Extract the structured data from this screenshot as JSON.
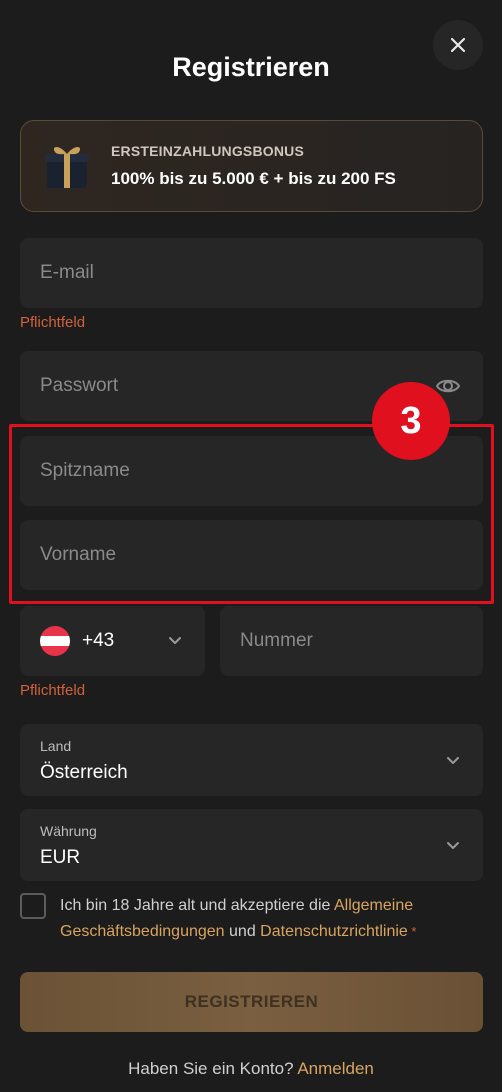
{
  "header": {
    "title": "Registrieren",
    "close_icon": "close-icon"
  },
  "bonus": {
    "label": "ERSTEINZAHLUNGSBONUS",
    "value": "100% bis zu 5.000 € + bis zu 200 FS",
    "icon": "gift-icon"
  },
  "fields": {
    "email": {
      "placeholder": "E-mail",
      "error": "Pflichtfeld"
    },
    "password": {
      "placeholder": "Passwort",
      "icon": "eye-icon"
    },
    "nickname": {
      "placeholder": "Spitzname"
    },
    "firstname": {
      "placeholder": "Vorname"
    },
    "phone": {
      "country_code": "+43",
      "placeholder": "Nummer",
      "error": "Pflichtfeld",
      "flag": "austria-flag-icon"
    }
  },
  "country": {
    "label": "Land",
    "value": "Österreich"
  },
  "currency": {
    "label": "Währung",
    "value": "EUR"
  },
  "terms": {
    "text_before": "Ich bin 18 Jahre alt und akzeptiere die ",
    "link1": "Allgemeine Geschäftsbedingungen",
    "text_mid": " und ",
    "link2": "Datenschutzrichtlinie",
    "required_mark": " *"
  },
  "submit": {
    "label": "REGISTRIEREN"
  },
  "footer": {
    "text": "Haben Sie ein Konto? ",
    "link": "Anmelden"
  },
  "annotation": {
    "badge": "3"
  },
  "colors": {
    "accent": "#d9a45f",
    "error": "#d4603a",
    "highlight": "#e0101e",
    "background": "#1c1c1c",
    "field": "#262626"
  }
}
